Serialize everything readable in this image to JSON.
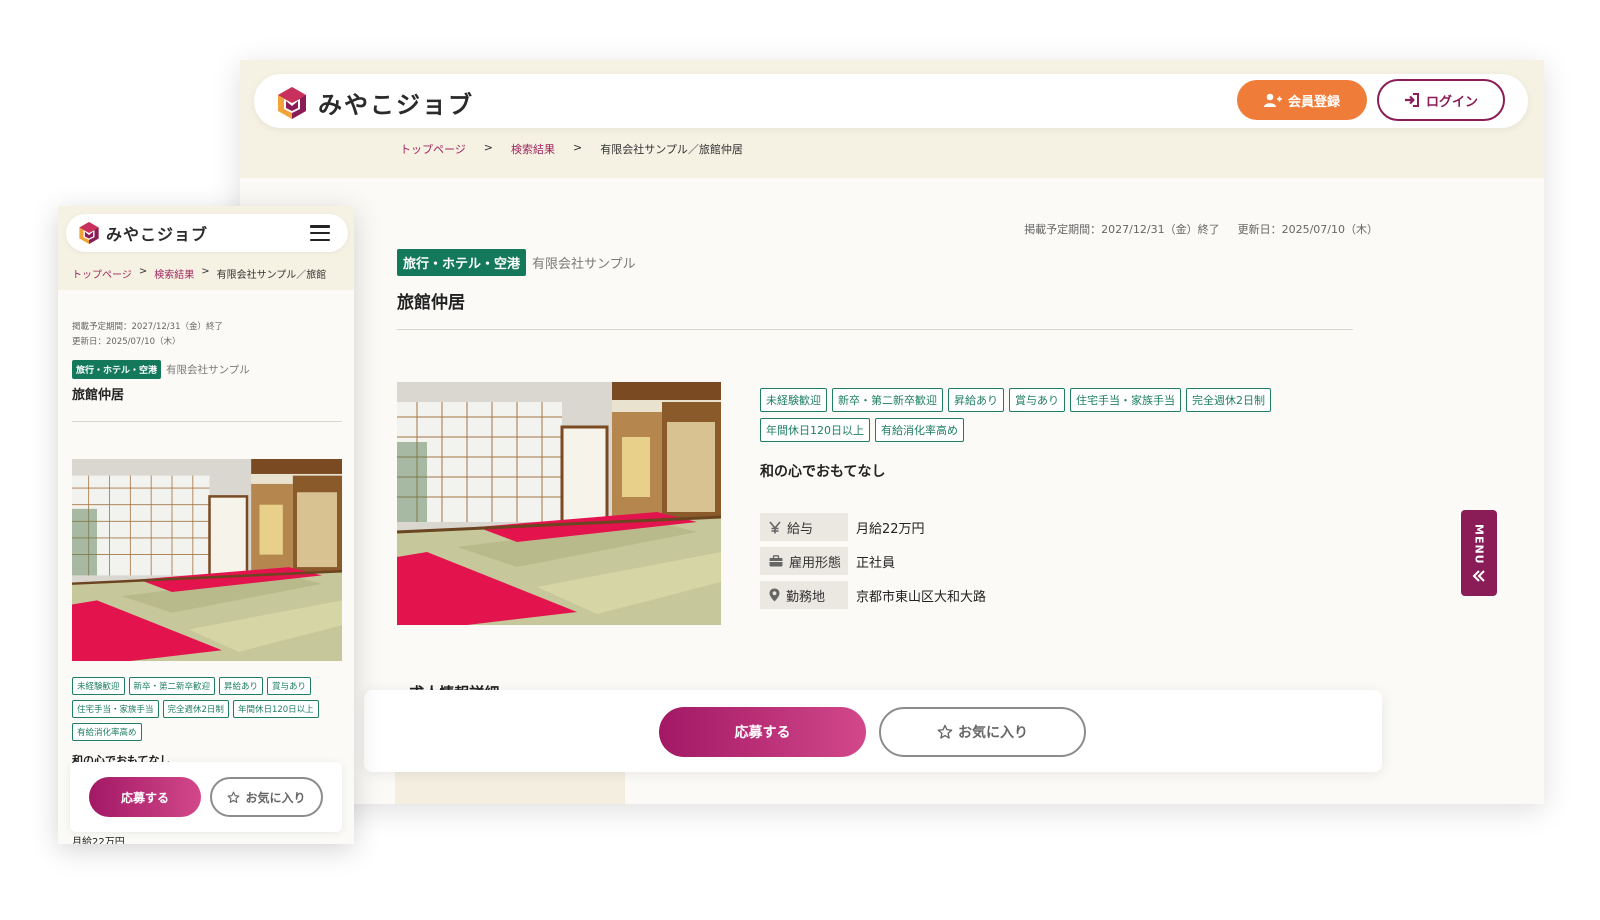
{
  "brand": {
    "logo_text": "みやこジョブ",
    "primary_color": "#8a1d57",
    "accent_orange": "#f07c3a",
    "badge_green": "#14795b"
  },
  "header": {
    "register_label": "会員登録",
    "login_label": "ログイン",
    "menu_label": "MENU"
  },
  "breadcrumb": {
    "home": "トップページ",
    "results": "検索結果",
    "current": "有限会社サンプル／旅館仲居",
    "current_mobile": "有限会社サンプル／旅館",
    "separator": ">"
  },
  "job": {
    "period": "掲載予定期間：2027/12/31（金）終了",
    "updated": "更新日：2025/07/10（木）",
    "category": "旅行・ホテル・空港",
    "company": "有限会社サンプル",
    "title": "旅館仲居",
    "catchphrase": "和の心でおもてなし",
    "tags": [
      "未経験歓迎",
      "新卒・第二新卒歓迎",
      "昇給あり",
      "賞与あり",
      "住宅手当・家族手当",
      "完全週休2日制",
      "年間休日120日以上",
      "有給消化率高め"
    ],
    "info": [
      {
        "icon": "yen-icon",
        "label": "給与",
        "value": "月給22万円"
      },
      {
        "icon": "briefcase-icon",
        "label": "雇用形態",
        "value": "正社員"
      },
      {
        "icon": "map-pin-icon",
        "label": "勤務地",
        "value": "京都市東山区大和大路"
      }
    ],
    "section_title": "求人情報詳細",
    "section_arrow": "›"
  },
  "actions": {
    "apply_label": "応募する",
    "favorite_label": "お気に入り"
  }
}
